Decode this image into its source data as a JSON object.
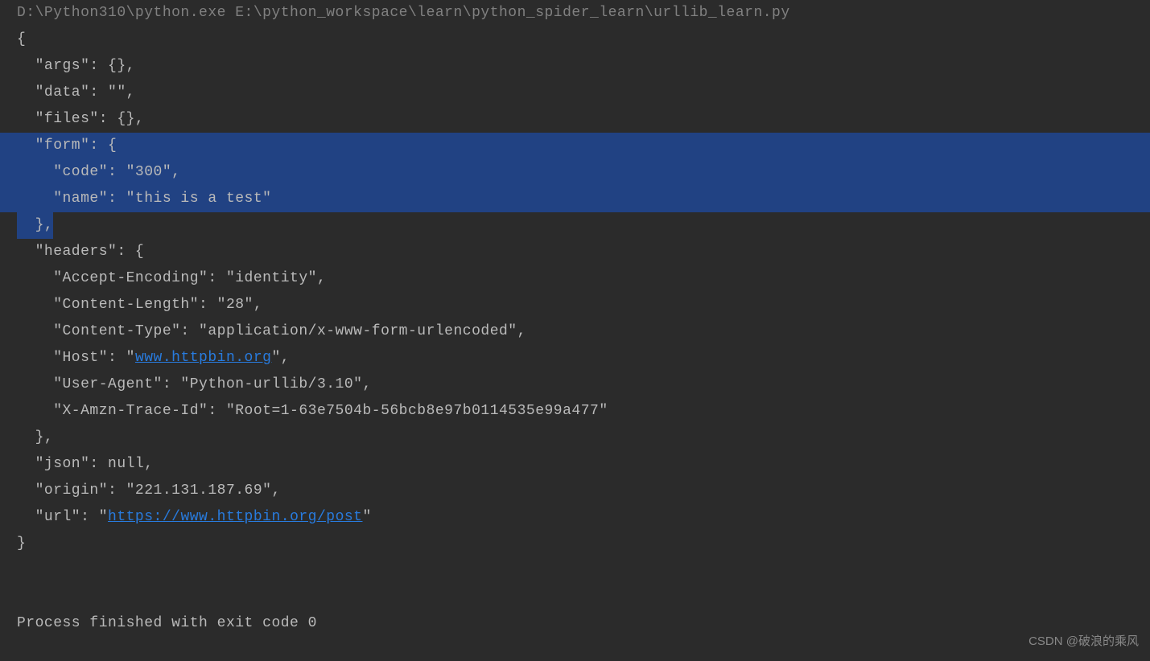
{
  "command": "D:\\Python310\\python.exe E:\\python_workspace\\learn\\python_spider_learn\\urllib_learn.py",
  "output": {
    "open": "{",
    "args": "  \"args\": {},",
    "data": "  \"data\": \"\",",
    "files": "  \"files\": {},",
    "form_open": "  \"form\": {",
    "form_code": "    \"code\": \"300\",",
    "form_name": "    \"name\": \"this is a test\"",
    "form_close": "  },",
    "headers_open": "  \"headers\": {",
    "accept_encoding": "    \"Accept-Encoding\": \"identity\",",
    "content_length": "    \"Content-Length\": \"28\",",
    "content_type": "    \"Content-Type\": \"application/x-www-form-urlencoded\",",
    "host_pre": "    \"Host\": \"",
    "host_link": "www.httpbin.org",
    "host_post": "\",",
    "user_agent": "    \"User-Agent\": \"Python-urllib/3.10\",",
    "trace_id": "    \"X-Amzn-Trace-Id\": \"Root=1-63e7504b-56bcb8e97b0114535e99a477\"",
    "headers_close": "  },",
    "json": "  \"json\": null,",
    "origin": "  \"origin\": \"221.131.187.69\",",
    "url_pre": "  \"url\": \"",
    "url_link": "https://www.httpbin.org/post",
    "url_post": "\"",
    "close": "}"
  },
  "exit": "Process finished with exit code 0",
  "watermark": "CSDN @破浪的乘风"
}
